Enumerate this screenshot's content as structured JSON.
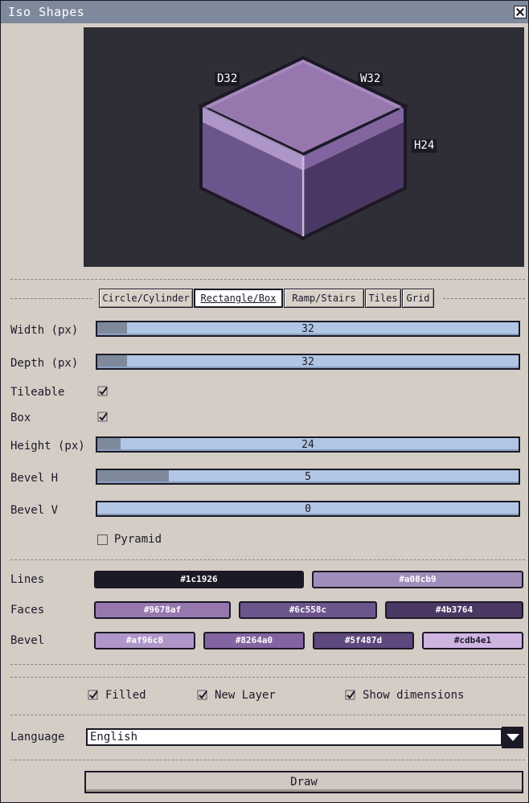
{
  "window": {
    "title": "Iso Shapes"
  },
  "preview": {
    "depth_label": "D32",
    "width_label": "W32",
    "height_label": "H24"
  },
  "tabs": [
    {
      "label": "Circle/Cylinder",
      "active": false
    },
    {
      "label": "Rectangle/Box",
      "active": true
    },
    {
      "label": "Ramp/Stairs",
      "active": false
    },
    {
      "label": "Tiles",
      "active": false
    },
    {
      "label": "Grid",
      "active": false
    }
  ],
  "params": {
    "width": {
      "label": "Width (px)",
      "value": "32",
      "fraction": 0.07
    },
    "depth": {
      "label": "Depth (px)",
      "value": "32",
      "fraction": 0.07
    },
    "tileable": {
      "label": "Tileable",
      "checked": true
    },
    "box": {
      "label": "Box",
      "checked": true
    },
    "height": {
      "label": "Height (px)",
      "value": "24",
      "fraction": 0.055
    },
    "bevel_h": {
      "label": "Bevel H",
      "value": "5",
      "fraction": 0.17
    },
    "bevel_v": {
      "label": "Bevel V",
      "value": "0",
      "fraction": 0.0
    },
    "pyramid": {
      "label": "Pyramid",
      "checked": false
    }
  },
  "colors": {
    "lines": {
      "label": "Lines",
      "values": [
        "#1c1926",
        "#a08cb9"
      ]
    },
    "faces": {
      "label": "Faces",
      "values": [
        "#9678af",
        "#6c558c",
        "#4b3764"
      ]
    },
    "bevel": {
      "label": "Bevel",
      "values": [
        "#af96c8",
        "#8264a0",
        "#5f487d",
        "#cdb4e1"
      ]
    }
  },
  "options": {
    "filled": {
      "label": "Filled",
      "checked": true
    },
    "new_layer": {
      "label": "New Layer",
      "checked": true
    },
    "show_dimensions": {
      "label": "Show dimensions",
      "checked": true
    }
  },
  "language": {
    "label": "Language",
    "value": "English"
  },
  "draw": {
    "label": "Draw"
  }
}
